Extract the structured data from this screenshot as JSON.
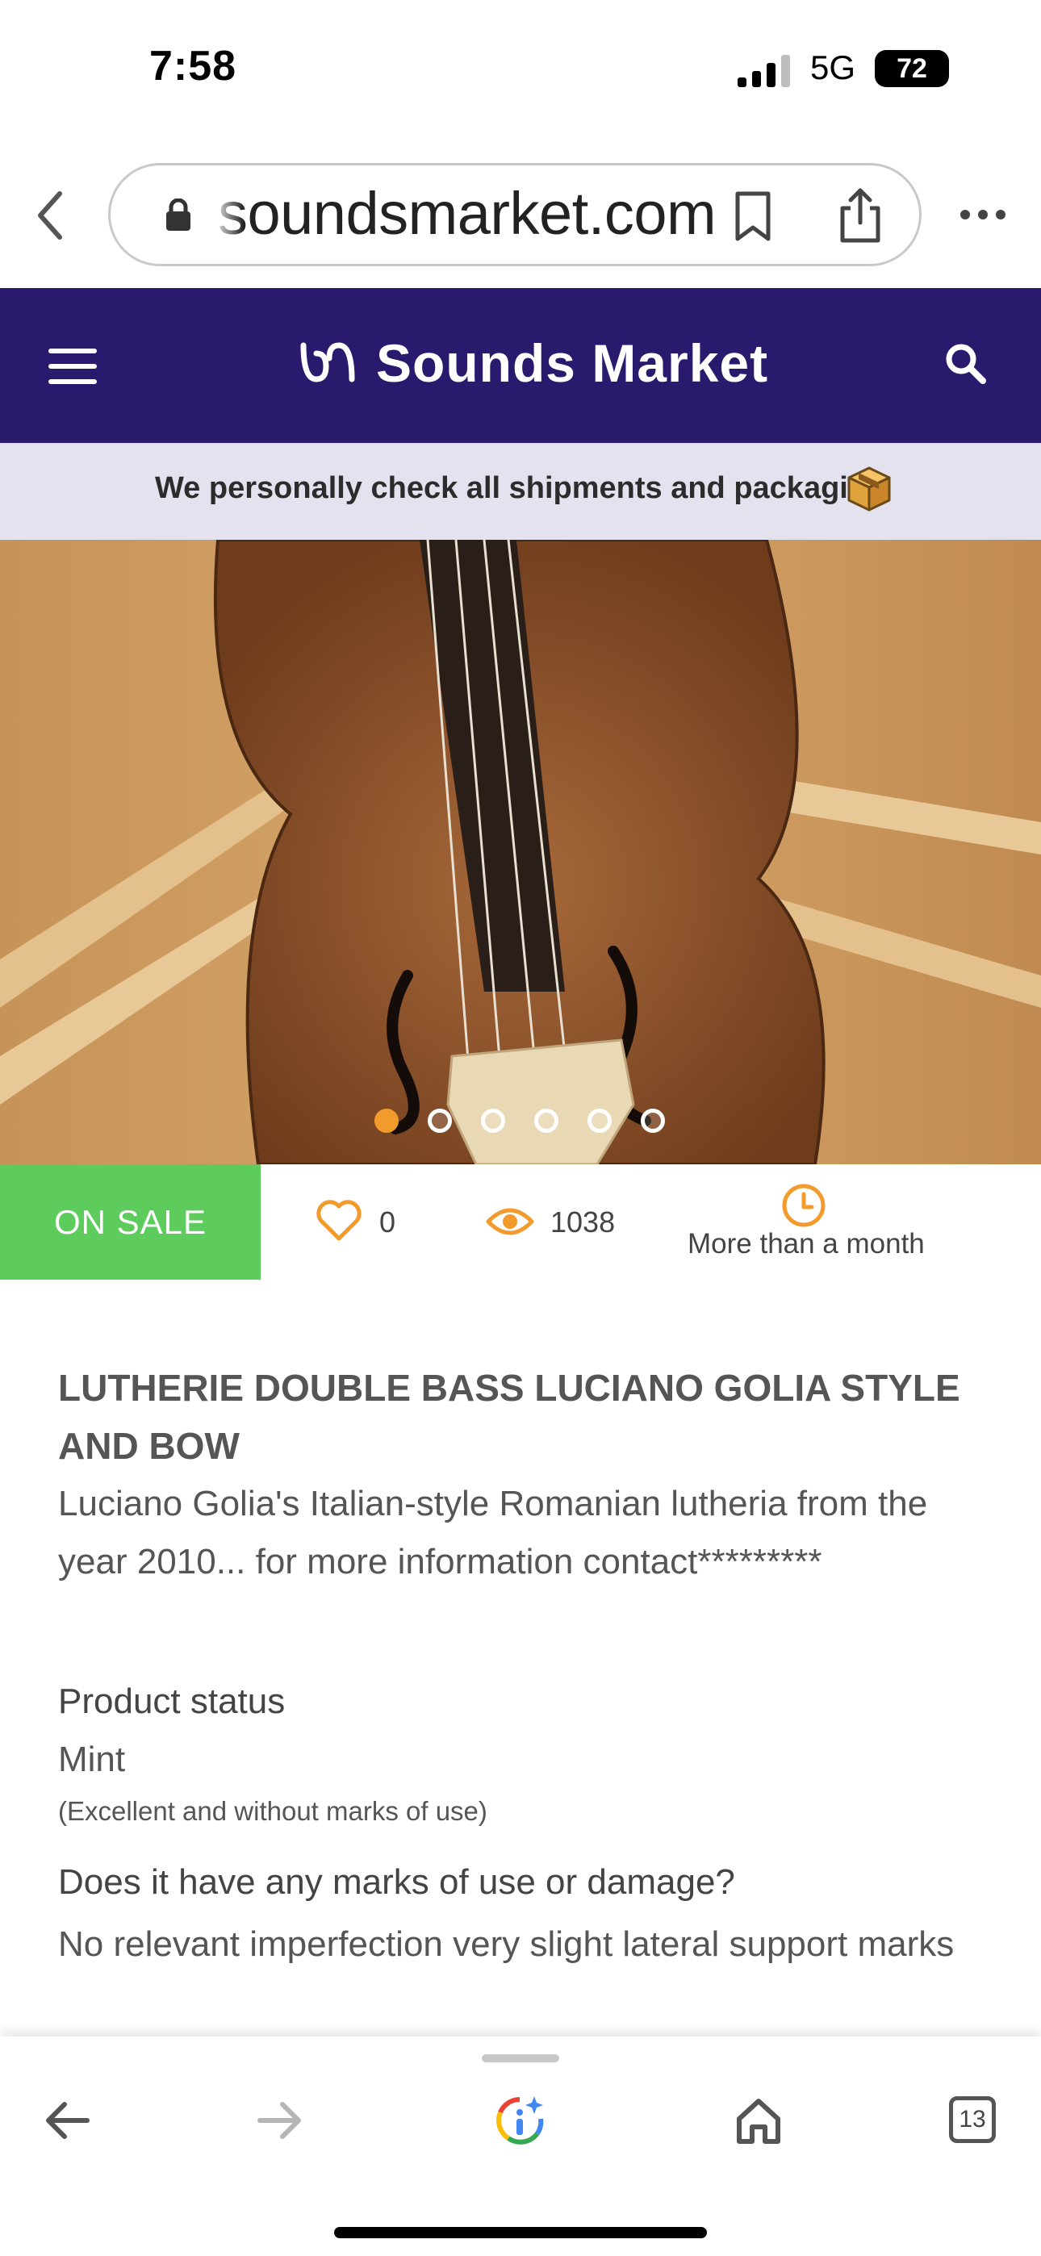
{
  "status_bar": {
    "time": "7:58",
    "network": "5G",
    "battery": "72"
  },
  "browser": {
    "url": "soundsmarket.com",
    "icons": [
      "back-icon",
      "lock-icon",
      "bookmark-icon",
      "share-icon",
      "more-icon"
    ]
  },
  "site": {
    "brand": "Sounds Market",
    "brand_color": "#2a1a6e",
    "accent_color": "#f39a2d"
  },
  "notice": {
    "text": "We personally check all shipments and packaging"
  },
  "gallery": {
    "total_images": 6,
    "active_index": 0
  },
  "stats": {
    "badge": "ON SALE",
    "likes": "0",
    "views": "1038",
    "posted": "More than a month"
  },
  "product": {
    "title": "LUTHERIE DOUBLE BASS LUCIANO GOLIA STYLE AND BOW",
    "description": "Luciano Golia's Italian-style Romanian lutheria from the year 2010... for more information contact*********",
    "status_label": "Product status",
    "status_value": "Mint",
    "status_note": "(Excellent and without marks of use)",
    "marks_question": "Does it have any marks of use or damage?",
    "marks_answer": "No relevant imperfection very slight lateral support marks"
  },
  "toolbar": {
    "tabs_count": "13"
  }
}
